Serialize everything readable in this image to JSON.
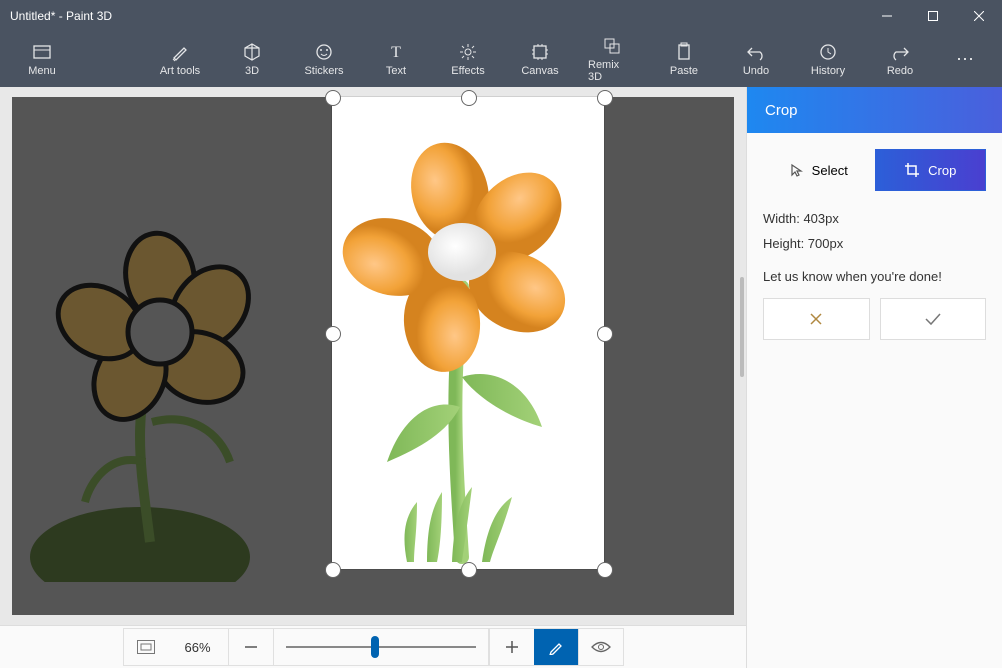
{
  "window": {
    "title": "Untitled* - Paint 3D"
  },
  "toolbar": {
    "menu": "Menu",
    "art_tools": "Art tools",
    "three_d": "3D",
    "stickers": "Stickers",
    "text": "Text",
    "effects": "Effects",
    "canvas": "Canvas",
    "remix": "Remix 3D",
    "paste": "Paste",
    "undo": "Undo",
    "history": "History",
    "redo": "Redo"
  },
  "side": {
    "header": "Crop",
    "select_label": "Select",
    "crop_label": "Crop",
    "width_label": "Width: 403px",
    "height_label": "Height: 700px",
    "prompt": "Let us know when you're done!"
  },
  "zoom": {
    "percent": "66%"
  },
  "colors": {
    "accent": "#0063b1",
    "toolbar_bg": "#4a5361",
    "side_header_from": "#1e88f0",
    "side_header_to": "#4a5fdc"
  }
}
